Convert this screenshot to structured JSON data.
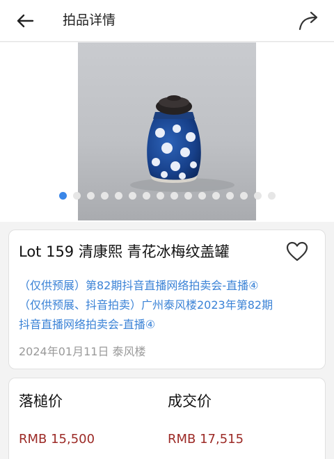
{
  "header": {
    "title": "拍品详情",
    "back_icon": "arrow-left-icon",
    "share_icon": "share-arrow-icon"
  },
  "gallery": {
    "image_alt": "blue-and-white jar with wooden lid",
    "image_count": 15,
    "active_index": 0,
    "active_dot_color": "#3a86e8"
  },
  "lot": {
    "title": "Lot 159 清康熙 青花冰梅纹盖罐",
    "favorite_icon": "heart-outline-icon",
    "auction_lines": [
      "（仅供预展）第82期抖音直播网络拍卖会-直播④",
      "（仅供预展、抖音拍卖）广州泰风楼2023年第82期",
      "抖音直播网络拍卖会-直播④"
    ],
    "date_house": "2024年01月11日 泰风楼",
    "link_color": "#3a82d6"
  },
  "prices": {
    "hammer_label": "落槌价",
    "hammer_value": "RMB 15,500",
    "deal_label": "成交价",
    "deal_value": "RMB 17,515",
    "price_color": "#9c2a26"
  }
}
